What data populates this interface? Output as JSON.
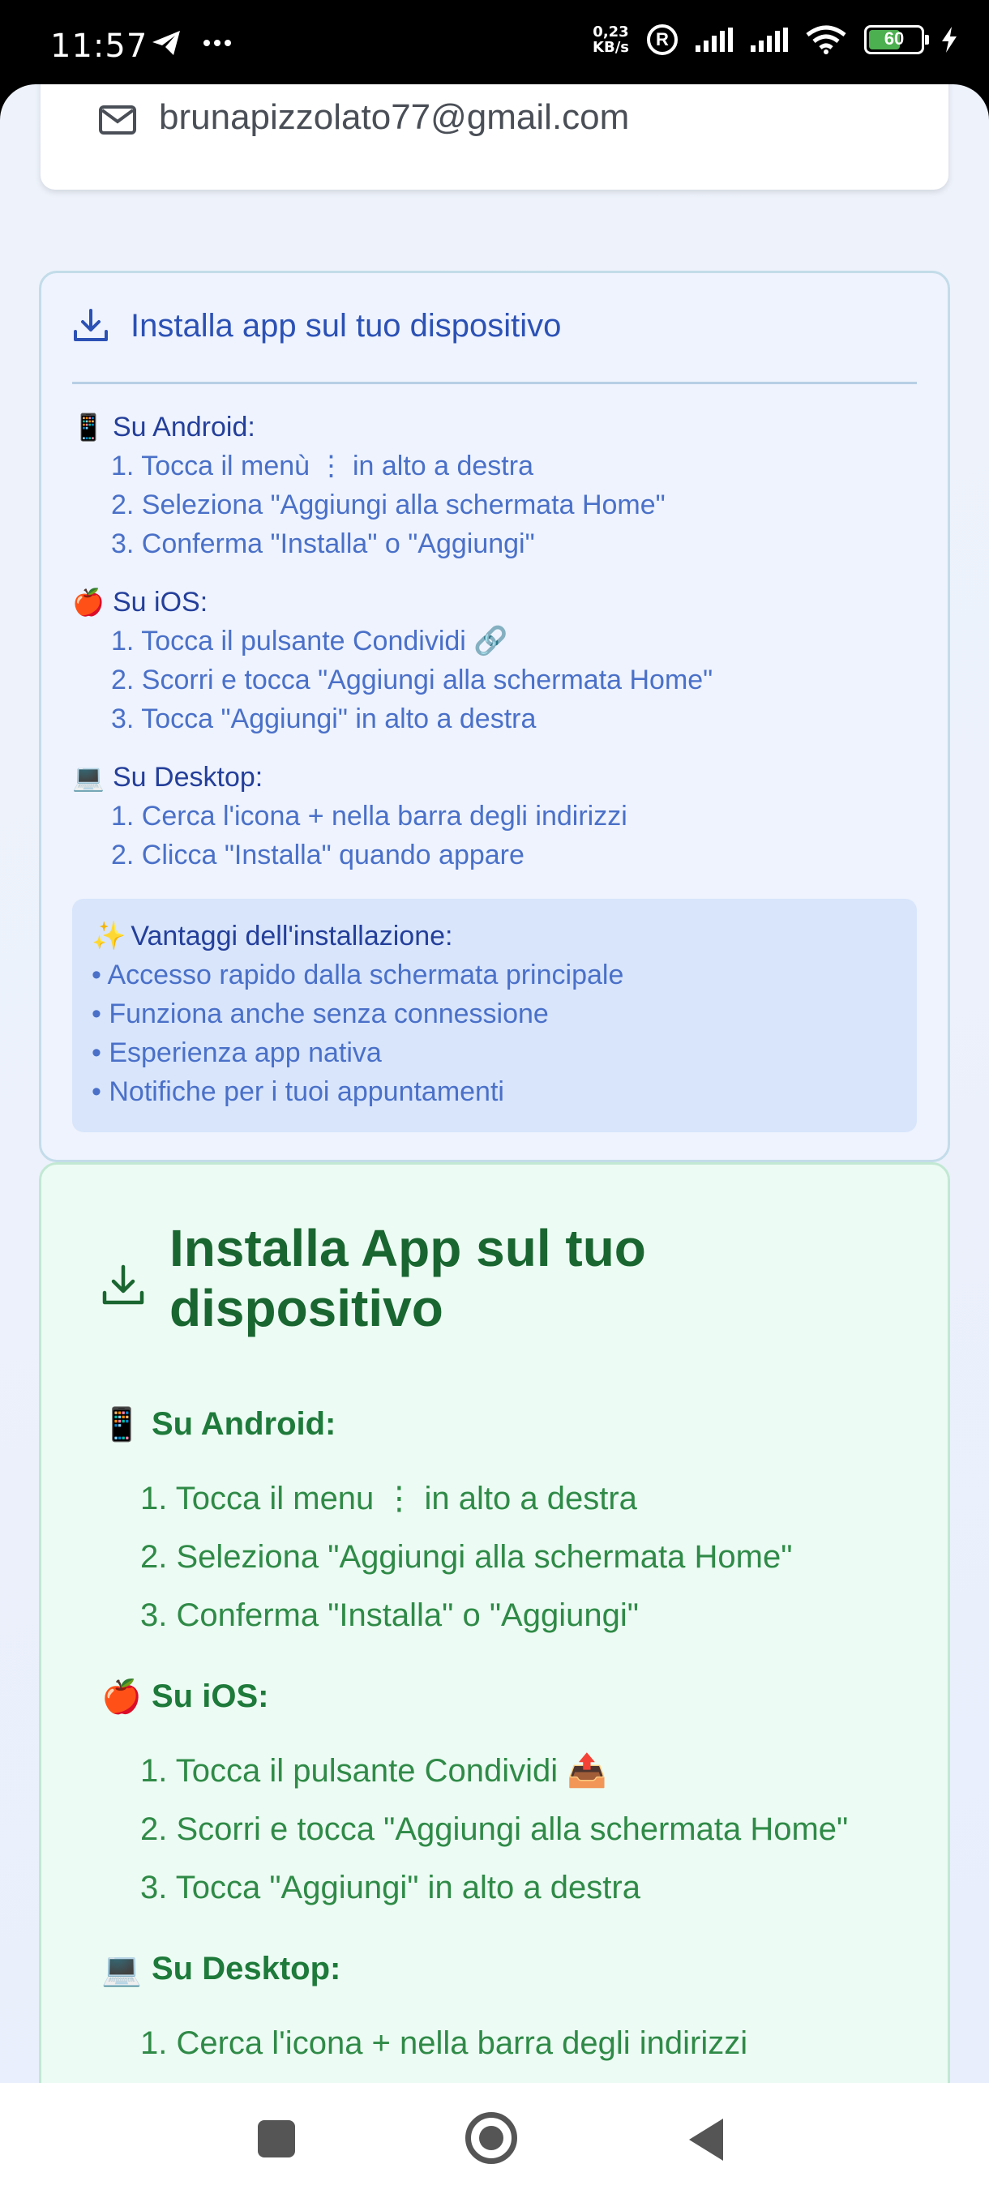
{
  "status_bar": {
    "time": "11:57",
    "net_speed_value": "0,23",
    "net_speed_unit": "KB/s",
    "roaming_badge": "R",
    "battery_level": "60"
  },
  "email": "brunapizzolato77@gmail.com",
  "install_box": {
    "title": "Installa app sul tuo dispositivo",
    "sections": [
      {
        "emoji": "📱",
        "heading": "Su Android:",
        "steps": [
          "1. Tocca il menù ⋮ in alto a destra",
          "2. Seleziona \"Aggiungi alla schermata Home\"",
          "3. Conferma \"Installa\" o \"Aggiungi\""
        ]
      },
      {
        "emoji": "🍎",
        "heading": "Su iOS:",
        "steps": [
          "1. Tocca il pulsante Condividi 🔗",
          "2. Scorri e tocca \"Aggiungi alla schermata Home\"",
          "3. Tocca \"Aggiungi\" in alto a destra"
        ]
      },
      {
        "emoji": "💻",
        "heading": "Su Desktop:",
        "steps": [
          "1. Cerca l'icona + nella barra degli indirizzi",
          "2. Clicca \"Installa\" quando appare"
        ]
      }
    ],
    "benefits": {
      "emoji": "✨",
      "heading": "Vantaggi dell'installazione:",
      "items": [
        "• Accesso rapido dalla schermata principale",
        "• Funziona anche senza connessione",
        "• Esperienza app nativa",
        "• Notifiche per i tuoi appuntamenti"
      ]
    }
  },
  "install_card": {
    "title": "Installa App sul tuo dispositivo",
    "sections": [
      {
        "emoji": "📱",
        "heading": "Su Android:",
        "steps": [
          "1. Tocca il menu ⋮ in alto a destra",
          "2. Seleziona \"Aggiungi alla schermata Home\"",
          "3. Conferma \"Installa\" o \"Aggiungi\""
        ]
      },
      {
        "emoji": "🍎",
        "heading": "Su iOS:",
        "steps": [
          "1. Tocca il pulsante Condividi 📤",
          "2. Scorri e tocca \"Aggiungi alla schermata Home\"",
          "3. Tocca \"Aggiungi\" in alto a destra"
        ]
      },
      {
        "emoji": "💻",
        "heading": "Su Desktop:",
        "steps": [
          "1. Cerca l'icona + nella barra degli indirizzi"
        ]
      }
    ]
  }
}
